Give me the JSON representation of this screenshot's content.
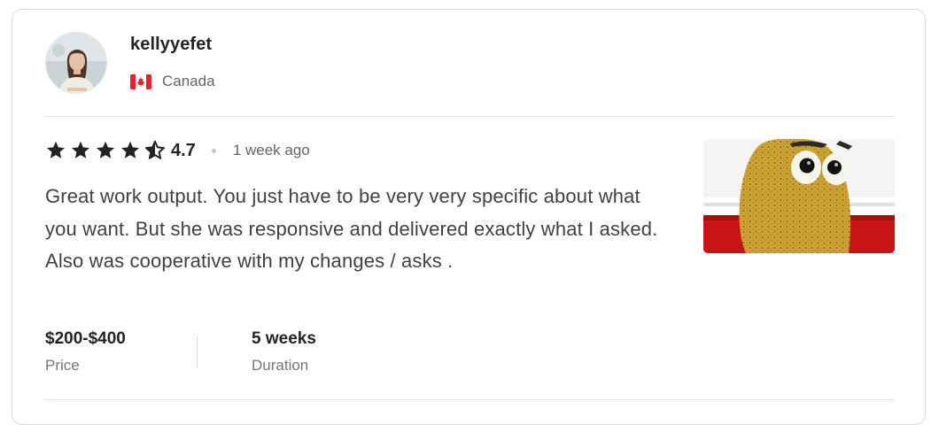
{
  "reviewer": {
    "username": "kellyyefet",
    "country": "Canada",
    "flag_icon": "canada-flag-icon",
    "avatar_icon": "user-avatar"
  },
  "review": {
    "rating": "4.7",
    "rating_fraction": 0.94,
    "stars_icon": "star-icon",
    "time_ago": "1 week ago",
    "text": "Great work output. You just have to be very very specific about what you want. But she was responsive and delivered exactly what I asked. Also was cooperative with my changes / asks .",
    "image": "crochet-potato-plush-photo"
  },
  "meta": {
    "price_value": "$200-$400",
    "price_label": "Price",
    "duration_value": "5 weeks",
    "duration_label": "Duration"
  },
  "colors": {
    "star": "#222325",
    "text": "#404145",
    "muted": "#62646a",
    "flag_red": "#e0242f"
  }
}
